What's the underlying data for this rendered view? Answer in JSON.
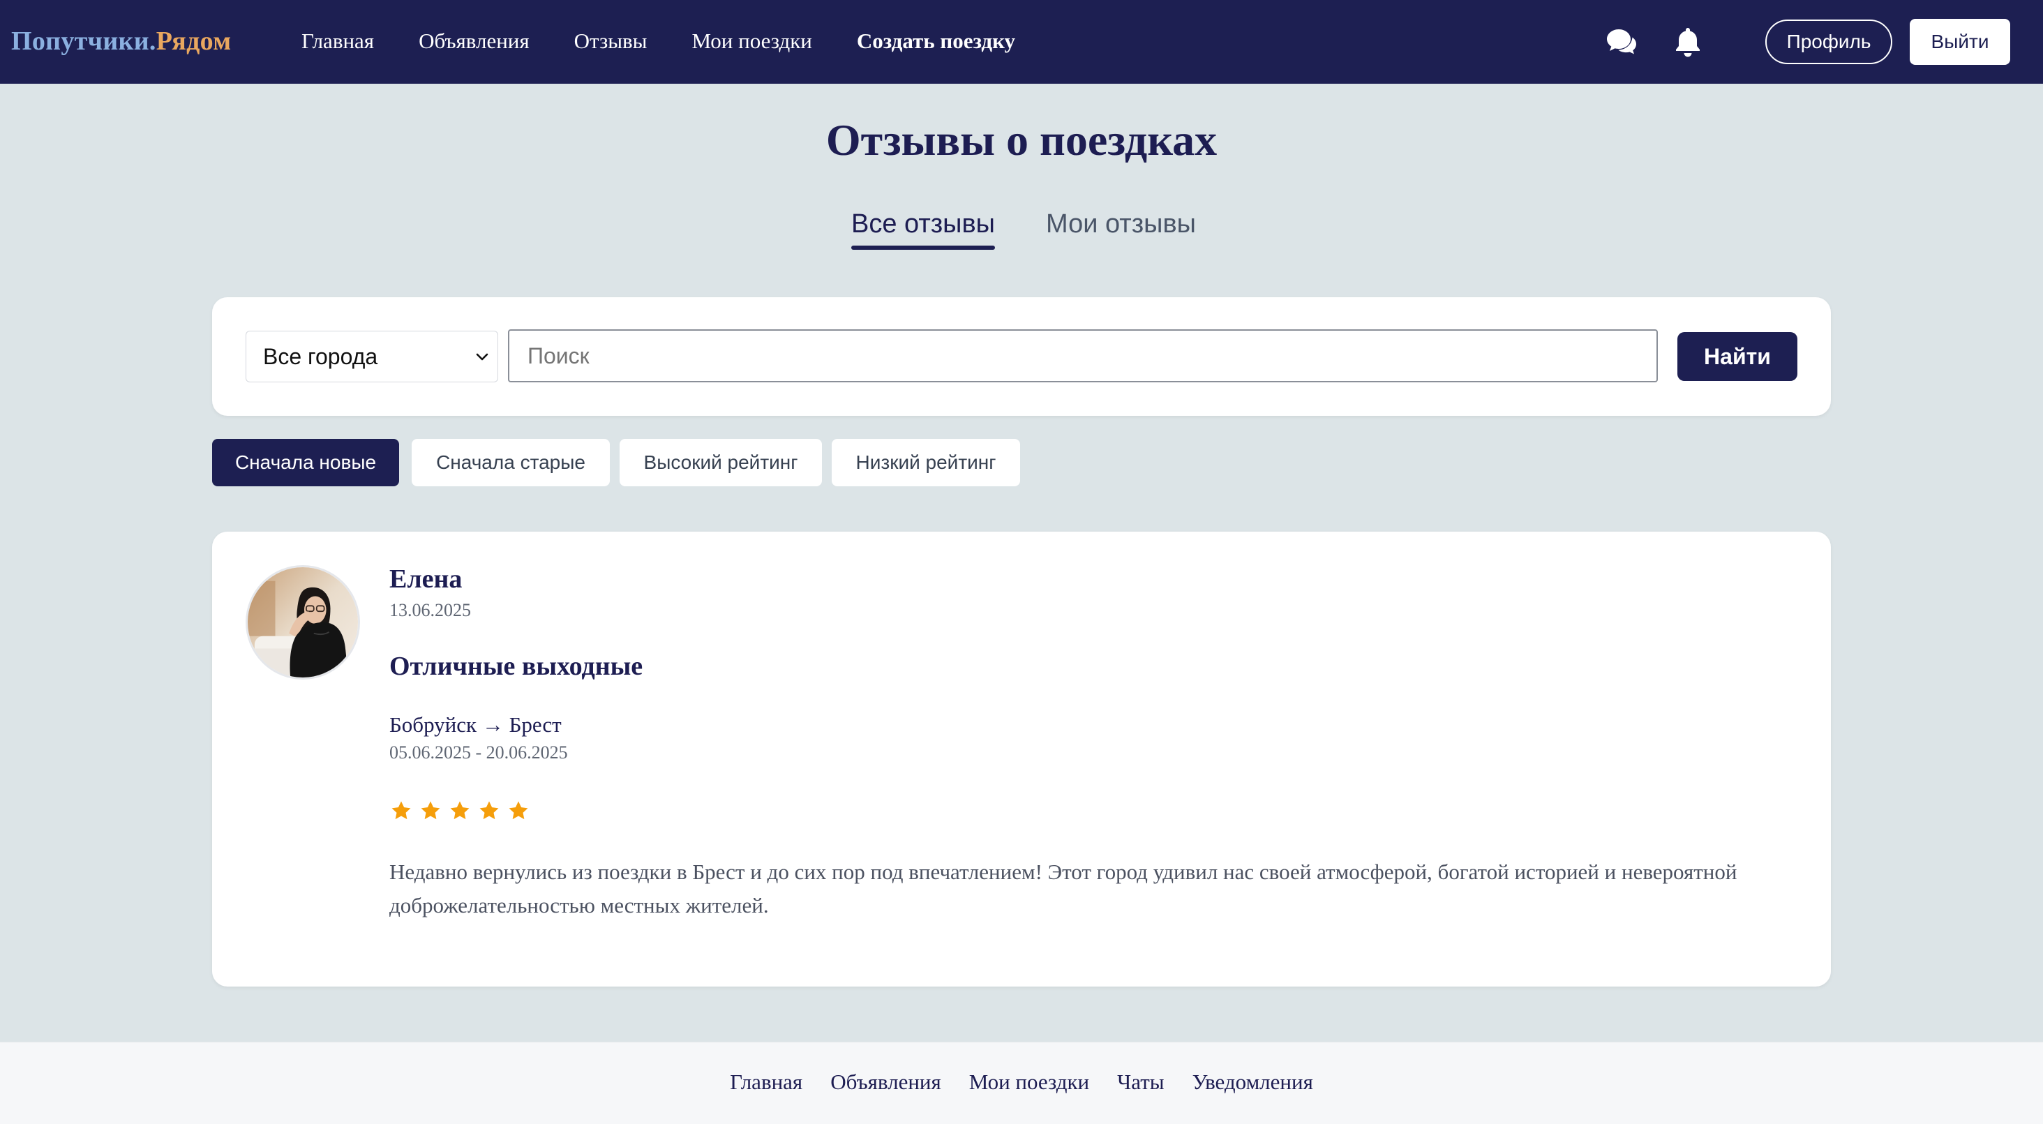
{
  "header": {
    "logo_part1": "Попутчики.",
    "logo_part2": "Рядом",
    "nav": [
      {
        "label": "Главная"
      },
      {
        "label": "Объявления"
      },
      {
        "label": "Отзывы"
      },
      {
        "label": "Мои поездки"
      },
      {
        "label": "Создать поездку"
      }
    ],
    "icons": [
      "chat-icon",
      "bell-icon"
    ],
    "profile_label": "Профиль",
    "logout_label": "Выйти"
  },
  "page": {
    "title": "Отзывы о поездках",
    "tabs": [
      {
        "label": "Все отзывы",
        "active": true
      },
      {
        "label": "Мои отзывы",
        "active": false
      }
    ]
  },
  "search": {
    "city_value": "Все города",
    "placeholder": "Поиск",
    "value": "",
    "button_label": "Найти"
  },
  "sort": [
    {
      "label": "Сначала новые",
      "active": true
    },
    {
      "label": "Сначала старые",
      "active": false
    },
    {
      "label": "Высокий рейтинг",
      "active": false
    },
    {
      "label": "Низкий рейтинг",
      "active": false
    }
  ],
  "reviews": [
    {
      "author": "Елена",
      "date": "13.06.2025",
      "title": "Отличные выходные",
      "route": "Бобруйск → Брест",
      "trip_dates": "05.06.2025 - 20.06.2025",
      "rating": 5,
      "rating_max": 5,
      "text": "Недавно вернулись из поездки в Брест и до сих пор под впечатлением! Этот город удивил нас своей атмосферой, богатой историей и невероятной доброжелательностью местных жителей."
    }
  ],
  "footer": {
    "links": [
      {
        "label": "Главная"
      },
      {
        "label": "Объявления"
      },
      {
        "label": "Мои поездки"
      },
      {
        "label": "Чаты"
      },
      {
        "label": "Уведомления"
      }
    ]
  },
  "colors": {
    "header_bg": "#1d1f52",
    "page_bg": "#dce4e7",
    "accent": "#1d1f52",
    "star": "#f59e0b",
    "logo_blue": "#8bb0e0",
    "logo_orange": "#e9a75f"
  }
}
